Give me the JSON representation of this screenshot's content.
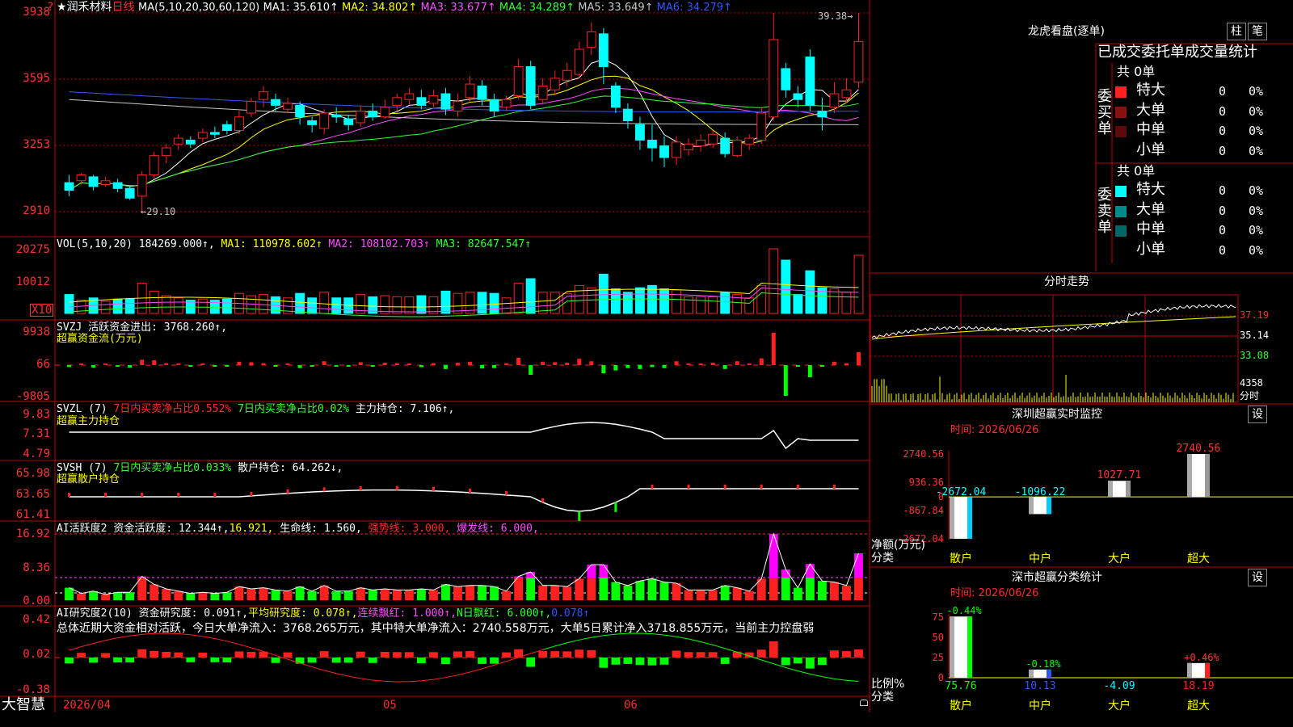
{
  "stock": {
    "star": "★",
    "name": "润禾材料",
    "period": "日线"
  },
  "main": {
    "ma_label": "MA(5,10,20,30,60,120)",
    "ma": [
      {
        "k": "MA1:",
        "v": "35.610↑",
        "c": "#ffffff"
      },
      {
        "k": "MA2:",
        "v": "34.802↑",
        "c": "#ffff00"
      },
      {
        "k": "MA3:",
        "v": "33.677↑",
        "c": "#ff4dff"
      },
      {
        "k": "MA4:",
        "v": "34.289↑",
        "c": "#33ff33"
      },
      {
        "k": "MA5:",
        "v": "33.649↑",
        "c": "#c8c8c8"
      },
      {
        "k": "MA6:",
        "v": "34.279↑",
        "c": "#3355ff"
      }
    ],
    "y_ticks": [
      "3938",
      "3595",
      "3253",
      "2910"
    ],
    "high_label": "39.38→",
    "low_label": "←29.10",
    "flag": "?"
  },
  "vol": {
    "label": "VOL(5,10,20)",
    "v": "184269.000↑",
    "ma": [
      {
        "k": "MA1:",
        "v": "110978.602↑",
        "c": "#ffff00"
      },
      {
        "k": "MA2:",
        "v": "108102.703↑",
        "c": "#ff4dff"
      },
      {
        "k": "MA3:",
        "v": "82647.547↑",
        "c": "#33ff33"
      }
    ],
    "y_ticks": [
      "20275",
      "10012"
    ],
    "unit": "X10"
  },
  "svzj": {
    "line1": "SVZJ  活跃资金进出: 3768.260↑,",
    "line2": "超赢资金流(万元)",
    "y_ticks": [
      "9938",
      "66",
      "-9805"
    ]
  },
  "svzl": {
    "t1": "SVZL (7) ",
    "t2": "7日内买卖净占比0.552%",
    "t3": "7日内买卖净占比0.02%",
    "t4": "主力持仓: 7.106↑,",
    "line2": "超赢主力持仓",
    "y_ticks": [
      "9.83",
      "7.31",
      "4.79"
    ]
  },
  "svsh": {
    "t1": "SVSH (7) ",
    "t2": "7日内买卖净占比0.033%",
    "t3": "散户持仓: 64.262↓,",
    "line2": "超赢散户持仓",
    "y_ticks": [
      "65.98",
      "63.65",
      "61.41"
    ]
  },
  "ai1": {
    "t1": "AI活跃度2",
    "t2": "资金活跃度: 12.344↑,",
    "t3": "16.921,",
    "t4": "生命线: 1.560,",
    "t5": "强势线: 3.000,",
    "t6": "爆发线: 6.000,",
    "y_ticks": [
      "16.92",
      "8.36",
      "0.00"
    ]
  },
  "ai2": {
    "t1": "AI研究度2(10)",
    "t2": "资金研究度: 0.091↑,",
    "t3": "平均研究度: 0.078↑,",
    "t4": "连续飘红: 1.000↑,",
    "t5": "N日飘红: 6.000↑,",
    "t6": "0.078↑",
    "summary": "总体近期大资金相对活跃，今日大单净流入：3768.265万元，其中特大单净流入：2740.558万元，大单5日累计净入3718.855万元，当前主力控盘弱",
    "y_ticks": [
      "0.42",
      "0.02",
      "-0.38"
    ]
  },
  "xaxis": {
    "d1": "2026/04",
    "d2": "05",
    "d3": "06"
  },
  "brand": "大智慧",
  "dragon": {
    "title": "龙虎看盘(逐单)",
    "btn1": "柱",
    "btn2": "笔",
    "tab": "已成交委托单成交量统计",
    "buy_label": "委买单",
    "sell_label": "委卖单",
    "total": "共 0单",
    "buy_rows": [
      {
        "n": "特大",
        "c": "#ff2020",
        "q": "0",
        "p": "0%"
      },
      {
        "n": "大单",
        "c": "#8b1010",
        "q": "0",
        "p": "0%"
      },
      {
        "n": "中单",
        "c": "#5a0a0a",
        "q": "0",
        "p": "0%"
      },
      {
        "n": "小单",
        "c": "#000000",
        "q": "0",
        "p": "0%"
      }
    ],
    "sell_rows": [
      {
        "n": "特大",
        "c": "#00ffff",
        "q": "0",
        "p": "0%"
      },
      {
        "n": "大单",
        "c": "#008b8b",
        "q": "0",
        "p": "0%"
      },
      {
        "n": "中单",
        "c": "#006666",
        "q": "0",
        "p": "0%"
      },
      {
        "n": "小单",
        "c": "#000000",
        "q": "0",
        "p": "0%"
      }
    ]
  },
  "intraday": {
    "title": "分时走势",
    "y": [
      "37.19",
      "35.14",
      "33.08"
    ],
    "vol": "4358",
    "vol_unit": "分时"
  },
  "sz_monitor": {
    "title": "深圳超赢实时监控",
    "btn": "设",
    "time": "时间: 2026/06/26",
    "y": [
      "2740.56",
      "936.36",
      "0",
      "-867.84",
      "-2672.04"
    ],
    "bars": [
      {
        "cat": "散户",
        "v": -2672.04,
        "label": "-2672.04"
      },
      {
        "cat": "中户",
        "v": -1096.22,
        "label": "-1096.22"
      },
      {
        "cat": "大户",
        "v": 1027.71,
        "label": "1027.71"
      },
      {
        "cat": "超大",
        "v": 2740.56,
        "label": "2740.56"
      }
    ],
    "ylabel": "净额(万元)",
    "xlabel": "分类"
  },
  "sz_class": {
    "title": "深市超赢分类统计",
    "btn": "设",
    "time": "时间: 2026/06/26",
    "y": [
      "75",
      "50",
      "25",
      "0"
    ],
    "bars": [
      {
        "cat": "散户",
        "v": 75.76,
        "top": "-0.44%",
        "val": "75.76"
      },
      {
        "cat": "中户",
        "v": 10.13,
        "top": "-0.18%",
        "val": "10.13"
      },
      {
        "cat": "大户",
        "v": -4.09,
        "top": "",
        "val": "-4.09"
      },
      {
        "cat": "超大",
        "v": 18.19,
        "top": "+0.46%",
        "val": "18.19"
      }
    ],
    "ylabel": "比例%",
    "xlabel": "分类"
  },
  "chart_data": [
    {
      "type": "candlestick",
      "title": "润禾材料 日线",
      "y_range": [
        29.1,
        39.38
      ],
      "candles": [
        [
          30.6,
          30.2,
          31.0,
          29.9
        ],
        [
          30.7,
          31.0,
          31.1,
          30.5
        ],
        [
          30.9,
          30.4,
          31.0,
          30.2
        ],
        [
          30.5,
          30.7,
          30.9,
          30.4
        ],
        [
          30.6,
          30.3,
          30.8,
          30.1
        ],
        [
          30.3,
          29.8,
          30.4,
          29.7
        ],
        [
          29.9,
          31.0,
          31.2,
          29.1
        ],
        [
          31.0,
          32.0,
          32.2,
          30.8
        ],
        [
          32.0,
          32.4,
          32.6,
          31.6
        ],
        [
          32.6,
          32.9,
          33.1,
          32.3
        ],
        [
          32.8,
          32.6,
          33.0,
          32.4
        ],
        [
          32.9,
          33.2,
          33.4,
          32.7
        ],
        [
          33.2,
          33.1,
          33.5,
          32.9
        ],
        [
          33.6,
          33.3,
          33.8,
          33.1
        ],
        [
          33.3,
          34.0,
          34.3,
          33.1
        ],
        [
          34.2,
          34.8,
          35.0,
          34.0
        ],
        [
          34.9,
          35.3,
          35.6,
          34.5
        ],
        [
          34.9,
          34.6,
          35.2,
          34.3
        ],
        [
          34.4,
          34.7,
          35.0,
          34.2
        ],
        [
          34.6,
          34.0,
          34.8,
          33.6
        ],
        [
          33.8,
          33.6,
          34.0,
          33.2
        ],
        [
          33.4,
          34.2,
          34.4,
          33.1
        ],
        [
          34.1,
          34.0,
          34.5,
          33.7
        ],
        [
          33.9,
          33.6,
          34.1,
          33.3
        ],
        [
          33.7,
          34.3,
          34.6,
          33.5
        ],
        [
          34.3,
          34.0,
          34.7,
          33.8
        ],
        [
          34.0,
          34.5,
          34.9,
          33.9
        ],
        [
          34.6,
          35.0,
          35.2,
          34.3
        ],
        [
          34.9,
          35.2,
          35.5,
          34.6
        ],
        [
          35.0,
          34.6,
          35.4,
          34.4
        ],
        [
          34.7,
          35.1,
          35.4,
          34.5
        ],
        [
          35.2,
          34.4,
          35.5,
          34.1
        ],
        [
          34.3,
          34.8,
          35.2,
          34.0
        ],
        [
          35.0,
          35.7,
          36.1,
          34.8
        ],
        [
          35.6,
          34.9,
          35.9,
          34.6
        ],
        [
          34.9,
          34.3,
          35.2,
          34.0
        ],
        [
          34.5,
          34.9,
          35.1,
          34.3
        ],
        [
          35.1,
          36.6,
          37.0,
          34.9
        ],
        [
          36.6,
          34.6,
          36.9,
          34.4
        ],
        [
          34.9,
          35.6,
          36.0,
          34.7
        ],
        [
          35.4,
          36.0,
          36.4,
          35.1
        ],
        [
          35.9,
          36.4,
          36.8,
          35.6
        ],
        [
          36.2,
          37.5,
          37.9,
          36.0
        ],
        [
          37.6,
          38.4,
          38.9,
          37.2
        ],
        [
          38.3,
          36.6,
          38.6,
          35.7
        ],
        [
          35.6,
          34.5,
          35.8,
          34.2
        ],
        [
          34.4,
          33.8,
          34.7,
          33.4
        ],
        [
          33.6,
          32.8,
          34.0,
          32.3
        ],
        [
          32.8,
          32.4,
          33.6,
          31.7
        ],
        [
          32.5,
          31.9,
          33.0,
          31.4
        ],
        [
          31.9,
          32.7,
          33.0,
          31.5
        ],
        [
          32.3,
          32.6,
          32.9,
          32.0
        ],
        [
          32.5,
          32.8,
          33.1,
          32.2
        ],
        [
          32.6,
          33.1,
          33.3,
          32.4
        ],
        [
          32.9,
          32.1,
          33.2,
          31.9
        ],
        [
          32.0,
          32.8,
          33.0,
          31.9
        ],
        [
          32.6,
          32.9,
          33.1,
          32.3
        ],
        [
          32.8,
          34.2,
          34.5,
          32.6
        ],
        [
          34.0,
          38.0,
          39.38,
          33.8
        ],
        [
          36.5,
          35.4,
          36.8,
          35.0
        ],
        [
          35.2,
          34.9,
          35.6,
          34.5
        ],
        [
          37.1,
          34.6,
          37.5,
          34.3
        ],
        [
          34.3,
          34.0,
          35.0,
          33.3
        ],
        [
          34.5,
          35.2,
          35.8,
          34.2
        ],
        [
          35.0,
          35.4,
          36.0,
          34.7
        ],
        [
          35.8,
          37.9,
          39.38,
          35.5
        ]
      ]
    }
  ]
}
